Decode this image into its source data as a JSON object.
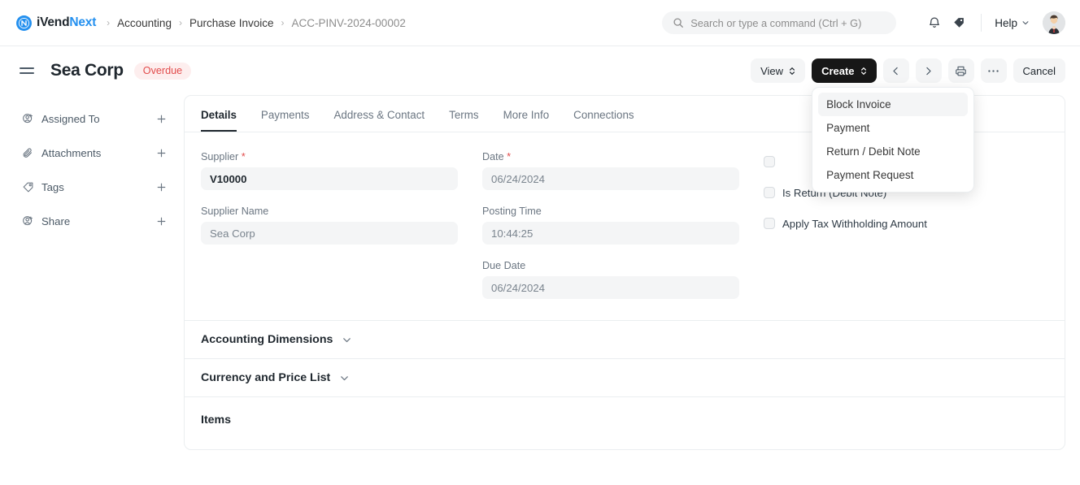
{
  "navbar": {
    "brand": {
      "first": "iVend",
      "second": "Next",
      "icon": "ivendnext-logo-icon"
    },
    "breadcrumbs": [
      {
        "label": "Accounting",
        "muted": false
      },
      {
        "label": "Purchase Invoice",
        "muted": false
      },
      {
        "label": "ACC-PINV-2024-00002",
        "muted": true
      }
    ],
    "separator": "›",
    "search": {
      "placeholder": "Search or type a command (Ctrl + G)",
      "value": "",
      "icon": "search-icon"
    },
    "notifications_icon": "bell-icon",
    "tags_icon": "tag-icon",
    "help": {
      "label": "Help",
      "icon": "chevron-down-icon"
    },
    "avatar_icon": "user-avatar"
  },
  "pagehead": {
    "menu_icon": "hamburger-menu-icon",
    "title": "Sea Corp",
    "status_badge": "Overdue",
    "status_color": "#e24c4c",
    "status_bg": "#fdeeee",
    "actions": {
      "view_label": "View",
      "create_label": "Create",
      "prev_icon": "chevron-left-icon",
      "next_icon": "chevron-right-icon",
      "print_icon": "printer-icon",
      "more_icon": "ellipsis-icon",
      "cancel_label": "Cancel"
    }
  },
  "create_menu": {
    "open": true,
    "items": [
      {
        "label": "Block Invoice",
        "active": true
      },
      {
        "label": "Payment",
        "active": false
      },
      {
        "label": "Return / Debit Note",
        "active": false
      },
      {
        "label": "Payment Request",
        "active": false
      }
    ]
  },
  "sidebar": {
    "items": [
      {
        "label": "Assigned To",
        "icon": "user-plus-icon",
        "action_icon": "plus-icon"
      },
      {
        "label": "Attachments",
        "icon": "paperclip-icon",
        "action_icon": "plus-icon"
      },
      {
        "label": "Tags",
        "icon": "tag-icon",
        "action_icon": "plus-icon"
      },
      {
        "label": "Share",
        "icon": "user-plus-icon",
        "action_icon": "plus-icon"
      }
    ]
  },
  "tabs": [
    {
      "label": "Details",
      "active": true
    },
    {
      "label": "Payments",
      "active": false
    },
    {
      "label": "Address & Contact",
      "active": false
    },
    {
      "label": "Terms",
      "active": false
    },
    {
      "label": "More Info",
      "active": false
    },
    {
      "label": "Connections",
      "active": false
    }
  ],
  "form": {
    "left": [
      {
        "label": "Supplier",
        "required": true,
        "value": "V10000",
        "strong": true
      },
      {
        "label": "Supplier Name",
        "required": false,
        "value": "Sea Corp",
        "strong": false
      }
    ],
    "middle": [
      {
        "label": "Date",
        "required": true,
        "value": "06/24/2024",
        "strong": false
      },
      {
        "label": "Posting Time",
        "required": false,
        "value": "10:44:25",
        "strong": false
      },
      {
        "label": "Due Date",
        "required": false,
        "value": "06/24/2024",
        "strong": false
      }
    ],
    "checkboxes": [
      {
        "label": "",
        "checked": false,
        "hidden_by_menu": true
      },
      {
        "label": "Is Return (Debit Note)",
        "checked": false,
        "hidden_by_menu": false
      },
      {
        "label": "Apply Tax Withholding Amount",
        "checked": false,
        "hidden_by_menu": false
      }
    ]
  },
  "sections": [
    {
      "title": "Accounting Dimensions",
      "collapsible": true,
      "icon": "chevron-down-icon"
    },
    {
      "title": "Currency and Price List",
      "collapsible": true,
      "icon": "chevron-down-icon"
    },
    {
      "title": "Items",
      "collapsible": false,
      "icon": ""
    }
  ]
}
